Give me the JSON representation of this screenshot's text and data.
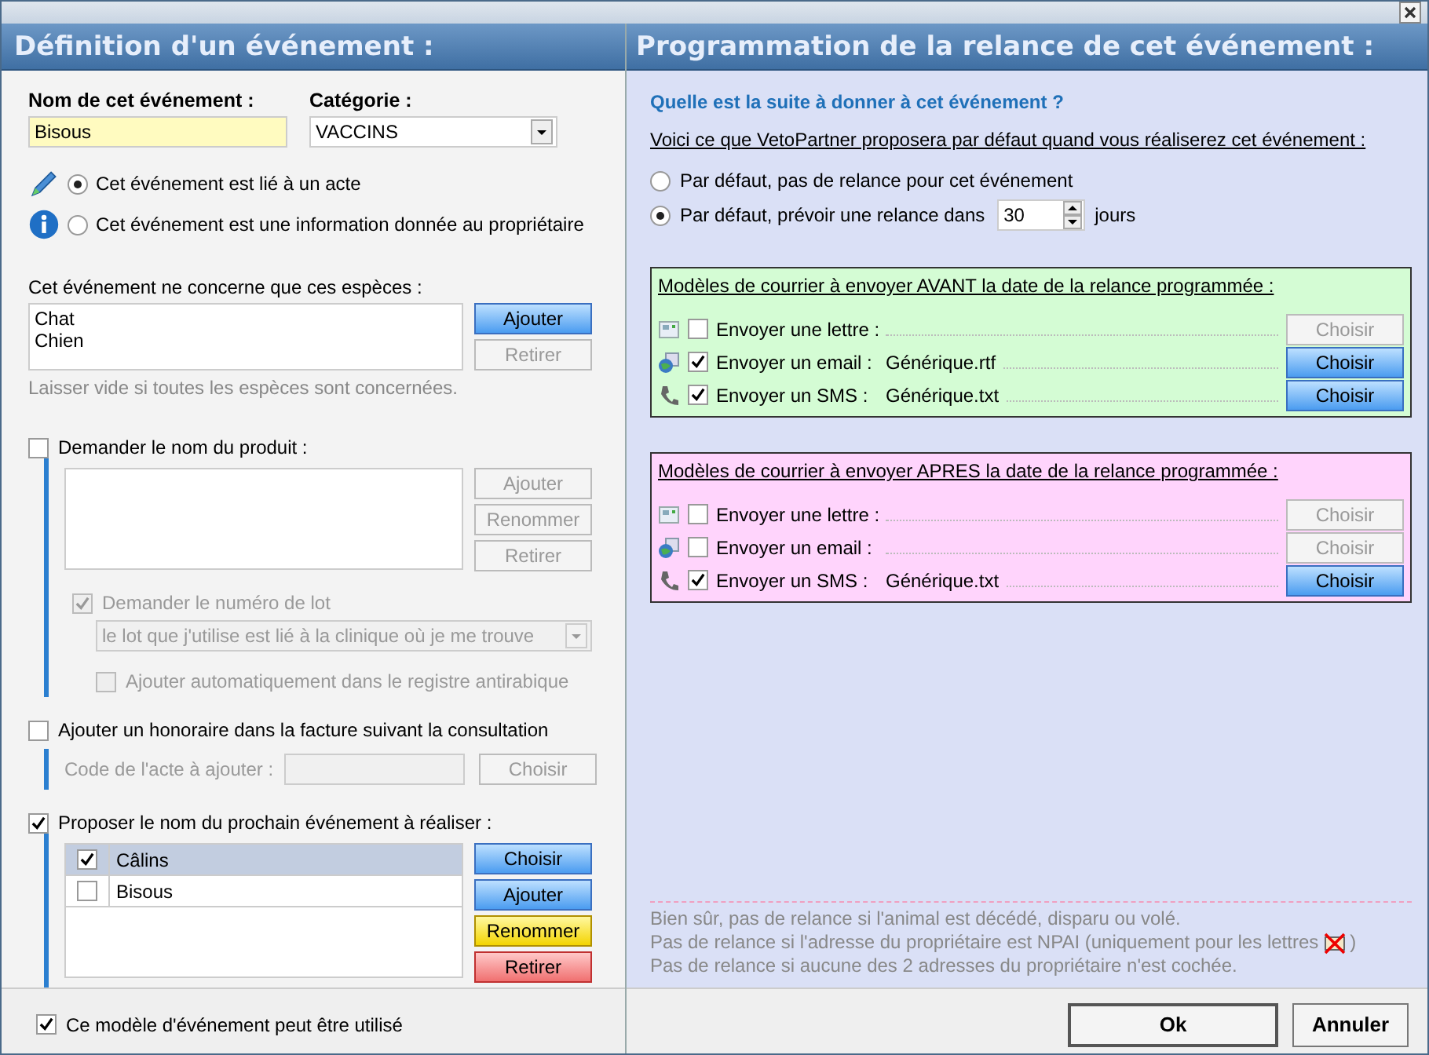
{
  "left": {
    "title": "Définition d'un événement :",
    "name_field": {
      "label": "Nom de cet événement :",
      "value": "Bisous"
    },
    "category": {
      "label": "Catégorie :",
      "value": "VACCINS"
    },
    "type_options": [
      {
        "kind": "act",
        "label": "Cet événement est lié à un acte",
        "selected": true
      },
      {
        "kind": "info",
        "label": "Cet événement est une information donnée au propriétaire",
        "selected": false
      }
    ],
    "species": {
      "label": "Cet événement ne concerne que ces espèces :",
      "items": [
        "Chat",
        "Chien"
      ],
      "buttons": [
        {
          "label": "Ajouter",
          "disabled": false
        },
        {
          "label": "Retirer",
          "disabled": true
        }
      ],
      "hint": "Laisser vide si toutes les espèces sont concernées."
    },
    "product": {
      "label": "Demander le nom du produit :",
      "checked": false,
      "buttons": [
        {
          "label": "Ajouter",
          "disabled": true
        },
        {
          "label": "Renommer",
          "disabled": true
        },
        {
          "label": "Retirer",
          "disabled": true
        }
      ],
      "lot": {
        "label": "Demander le numéro de lot",
        "checked": true,
        "disabled": true
      },
      "lot_select": {
        "value": "le lot que j'utilise est lié à la clinique où je me trouve",
        "disabled": true
      },
      "antirabies": {
        "label": "Ajouter automatiquement dans le registre antirabique",
        "checked": false,
        "disabled": true
      }
    },
    "fee": {
      "label": "Ajouter un honoraire dans la facture suivant la consultation",
      "checked": false,
      "code_label": "Code de l'acte à ajouter :",
      "button": {
        "label": "Choisir",
        "disabled": true
      }
    },
    "next_event": {
      "label": "Proposer le nom du prochain événement à réaliser :",
      "checked": true,
      "rows": [
        {
          "label": "Câlins",
          "checked": true,
          "selected": true
        },
        {
          "label": "Bisous",
          "checked": false,
          "selected": false
        }
      ],
      "buttons": [
        {
          "label": "Choisir",
          "kind": "blue"
        },
        {
          "label": "Ajouter",
          "kind": "blue"
        },
        {
          "label": "Renommer",
          "kind": "yellow"
        },
        {
          "label": "Retirer",
          "kind": "red"
        }
      ]
    },
    "usable": {
      "label": "Ce modèle d'événement peut être utilisé",
      "checked": true
    }
  },
  "right": {
    "title": "Programmation de la relance de cet événement :",
    "question": "Quelle est la suite à donner à cet événement ?",
    "intro": "Voici ce que VetoPartner proposera par défaut quand vous réaliserez cet événement :",
    "reminder_options": [
      {
        "label": "Par défaut, pas de relance pour cet événement",
        "selected": false
      },
      {
        "label": "Par défaut, prévoir une relance dans",
        "selected": true,
        "value": "30",
        "unit": "jours"
      }
    ],
    "mail_groups": [
      {
        "title": "Modèles de courrier à envoyer AVANT la date de la relance programmée :",
        "color": "#d4fcd4",
        "rows": [
          {
            "kind": "letter",
            "label": "Envoyer une lettre :",
            "checked": false,
            "button": {
              "label": "Choisir",
              "disabled": true
            }
          },
          {
            "kind": "email",
            "label": "Envoyer un email :",
            "checked": true,
            "file": "Générique.rtf",
            "button": {
              "label": "Choisir",
              "disabled": false
            }
          },
          {
            "kind": "sms",
            "label": "Envoyer un SMS :",
            "checked": true,
            "file": "Générique.txt",
            "button": {
              "label": "Choisir",
              "disabled": false
            }
          }
        ]
      },
      {
        "title": "Modèles de courrier à envoyer APRES la date de la relance programmée :",
        "color": "#ffd4fc",
        "rows": [
          {
            "kind": "letter",
            "label": "Envoyer une lettre :",
            "checked": false,
            "button": {
              "label": "Choisir",
              "disabled": true
            }
          },
          {
            "kind": "email",
            "label": "Envoyer un email :",
            "checked": false,
            "button": {
              "label": "Choisir",
              "disabled": true
            }
          },
          {
            "kind": "sms",
            "label": "Envoyer un SMS :",
            "checked": true,
            "file": "Générique.txt",
            "button": {
              "label": "Choisir",
              "disabled": false
            }
          }
        ]
      }
    ],
    "notes": [
      {
        "text": "Bien sûr, pas de relance si l'animal est décédé, disparu ou volé."
      },
      {
        "text": "Pas de relance si l'adresse du propriétaire est NPAI (uniquement pour les lettres",
        "tail": ")"
      },
      {
        "text": "Pas de relance si aucune des 2 adresses du propriétaire n'est cochée."
      }
    ],
    "buttons": [
      {
        "label": "Ok",
        "default": true
      },
      {
        "label": "Annuler",
        "default": false
      }
    ]
  }
}
